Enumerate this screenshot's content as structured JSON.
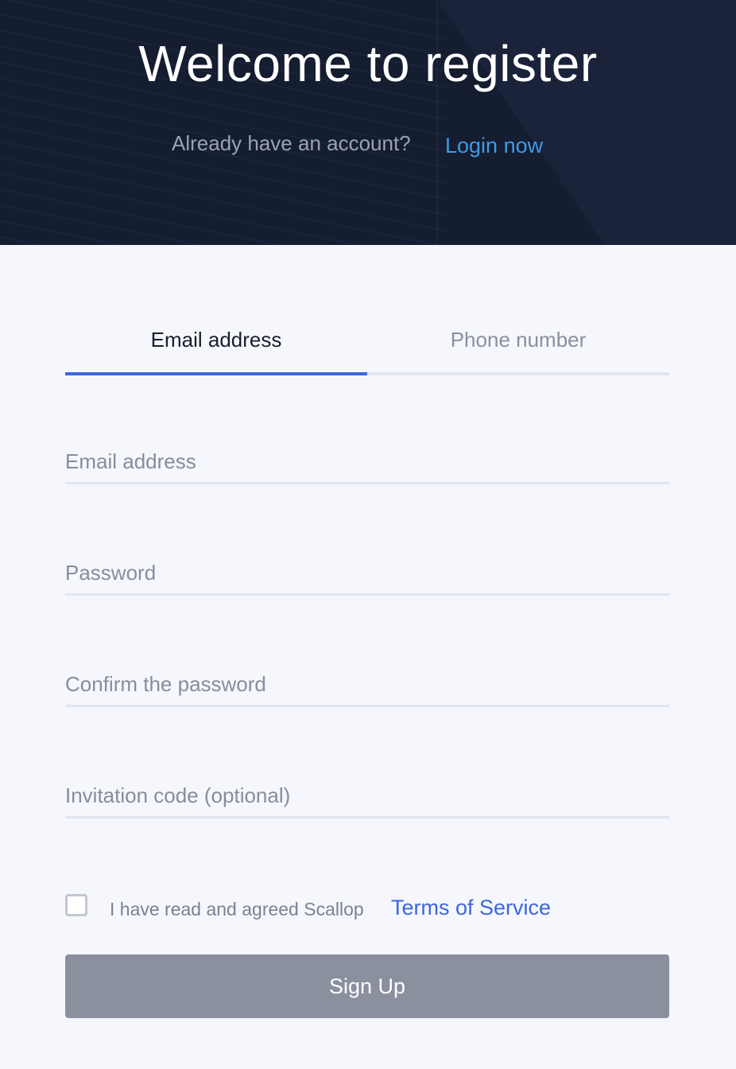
{
  "header": {
    "title": "Welcome to register",
    "account_question": "Already have an account?",
    "login_link": "Login now"
  },
  "tabs": [
    {
      "label": "Email address",
      "active": true
    },
    {
      "label": "Phone number",
      "active": false
    }
  ],
  "form": {
    "email": {
      "value": "",
      "placeholder": "Email address"
    },
    "password": {
      "value": "",
      "placeholder": "Password"
    },
    "confirm_password": {
      "value": "",
      "placeholder": "Confirm the password"
    },
    "invitation_code": {
      "value": "",
      "placeholder": "Invitation code (optional)"
    }
  },
  "agreement": {
    "checked": false,
    "text": "I have read and agreed Scallop",
    "link": "Terms of Service"
  },
  "submit": {
    "label": "Sign Up"
  },
  "colors": {
    "header_background": "#151d30",
    "accent": "#3c66e2",
    "login_link": "#3e9be8",
    "button_disabled": "#8a909e",
    "page_background": "#f5f7fc"
  }
}
